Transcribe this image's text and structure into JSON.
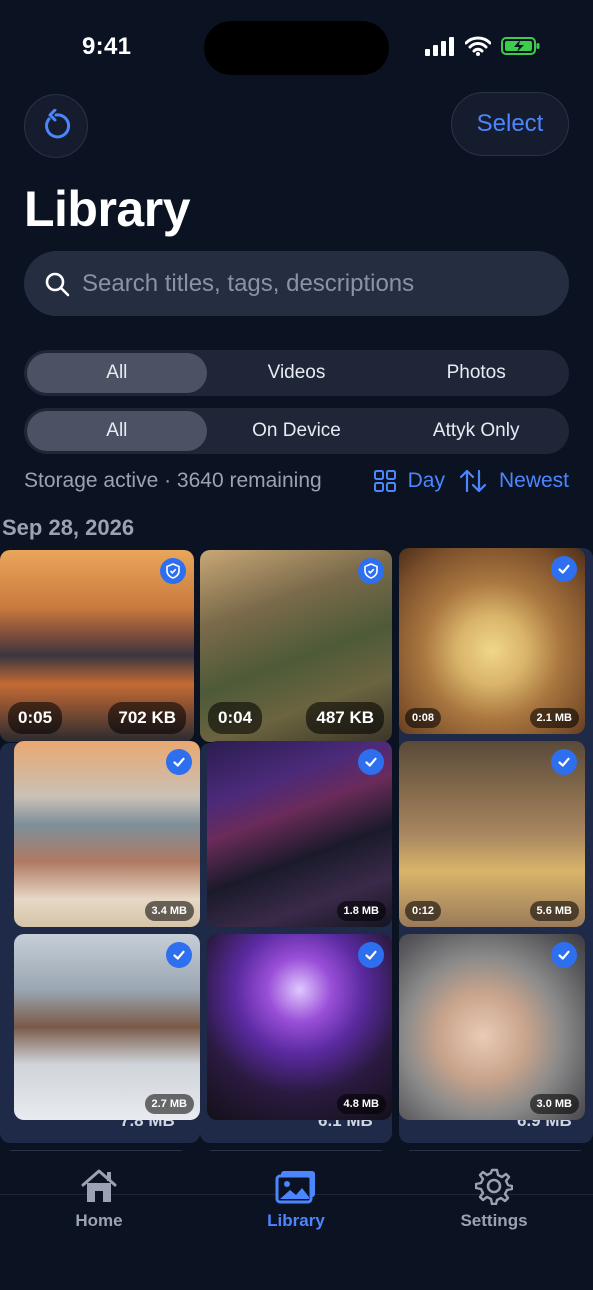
{
  "status": {
    "time": "9:41"
  },
  "header": {
    "select_label": "Select",
    "title": "Library"
  },
  "search": {
    "placeholder": "Search titles, tags, descriptions",
    "value": ""
  },
  "media_filter": {
    "items": [
      "All",
      "Videos",
      "Photos"
    ],
    "selected": "All"
  },
  "location_filter": {
    "items": [
      "All",
      "On Device",
      "Attyk Only"
    ],
    "selected": "All"
  },
  "info": {
    "storage": "Storage active · 3640 remaining",
    "group_label": "Day",
    "sort_label": "Newest"
  },
  "section": {
    "date": "Sep 28, 2026"
  },
  "items": [
    {
      "scene": "mountain lake sunset",
      "duration": "0:05",
      "size": "702 KB",
      "badge": "shield"
    },
    {
      "scene": "soccer match",
      "duration": "0:04",
      "size": "487 KB",
      "badge": "shield"
    },
    {
      "scene": "fresh pasta and wine",
      "duration": "0:08",
      "size": "2.1 MB",
      "badge": "check"
    },
    {
      "scene": "friends on beach",
      "duration": "",
      "size": "3.4 MB",
      "badge": "check"
    },
    {
      "scene": "neon street at night",
      "duration": "",
      "size": "1.8 MB",
      "badge": "check"
    },
    {
      "scene": "baby birthday cake",
      "duration": "0:12",
      "size": "5.6 MB",
      "badge": "check"
    },
    {
      "scene": "snowy cabin porch",
      "duration": "",
      "size": "2.7 MB",
      "badge": "check"
    },
    {
      "scene": "concert crowd",
      "duration": "",
      "size": "4.8 MB",
      "badge": "check"
    },
    {
      "scene": "parent holding newborn",
      "duration": "",
      "size": "3.0 MB",
      "badge": "check"
    }
  ],
  "ghost_sizes": [
    "7.8 MB",
    "6.1 MB",
    "6.9 MB"
  ],
  "tabs": [
    {
      "label": "Home",
      "icon": "house-icon"
    },
    {
      "label": "Library",
      "icon": "photos-icon",
      "active": true
    },
    {
      "label": "Settings",
      "icon": "gear-icon"
    }
  ],
  "colors": {
    "accent": "#4b86ff",
    "background": "#0b1222",
    "badge": "#2e6ff0"
  }
}
